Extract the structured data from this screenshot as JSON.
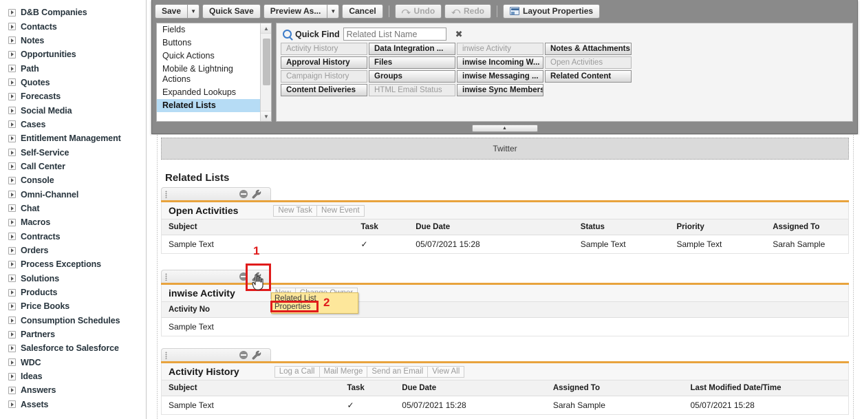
{
  "sidebar": {
    "items": [
      {
        "label": "D&B Companies"
      },
      {
        "label": "Contacts"
      },
      {
        "label": "Notes"
      },
      {
        "label": "Opportunities"
      },
      {
        "label": "Path"
      },
      {
        "label": "Quotes"
      },
      {
        "label": "Forecasts"
      },
      {
        "label": "Social Media"
      },
      {
        "label": "Cases"
      },
      {
        "label": "Entitlement Management"
      },
      {
        "label": "Self-Service"
      },
      {
        "label": "Call Center"
      },
      {
        "label": "Console"
      },
      {
        "label": "Omni-Channel"
      },
      {
        "label": "Chat"
      },
      {
        "label": "Macros"
      },
      {
        "label": "Contracts"
      },
      {
        "label": "Orders"
      },
      {
        "label": "Process Exceptions"
      },
      {
        "label": "Solutions"
      },
      {
        "label": "Products"
      },
      {
        "label": "Price Books"
      },
      {
        "label": "Consumption Schedules"
      },
      {
        "label": "Partners"
      },
      {
        "label": "Salesforce to Salesforce"
      },
      {
        "label": "WDC"
      },
      {
        "label": "Ideas"
      },
      {
        "label": "Answers"
      },
      {
        "label": "Assets"
      }
    ]
  },
  "toolbar": {
    "save_label": "Save",
    "quick_save_label": "Quick Save",
    "preview_as_label": "Preview As...",
    "cancel_label": "Cancel",
    "undo_label": "Undo",
    "redo_label": "Redo",
    "layout_properties_label": "Layout Properties",
    "dropdown_glyph": "▼"
  },
  "palette": {
    "categories": [
      {
        "label": "Fields",
        "selected": false
      },
      {
        "label": "Buttons",
        "selected": false
      },
      {
        "label": "Quick Actions",
        "selected": false
      },
      {
        "label": "Mobile & Lightning Actions",
        "selected": false
      },
      {
        "label": "Expanded Lookups",
        "selected": false
      },
      {
        "label": "Related Lists",
        "selected": true
      }
    ],
    "quick_find": {
      "label": "Quick Find",
      "placeholder": "Related List Name",
      "value": "",
      "clear_glyph": "✖"
    },
    "columns": [
      [
        {
          "label": "Activity History",
          "available": false
        },
        {
          "label": "Approval History",
          "available": true
        },
        {
          "label": "Campaign History",
          "available": false
        },
        {
          "label": "Content Deliveries",
          "available": true
        }
      ],
      [
        {
          "label": "Data Integration ...",
          "available": true
        },
        {
          "label": "Files",
          "available": true
        },
        {
          "label": "Groups",
          "available": true
        },
        {
          "label": "HTML Email Status",
          "available": false
        }
      ],
      [
        {
          "label": "inwise Activity",
          "available": false
        },
        {
          "label": "inwise Incoming W...",
          "available": true
        },
        {
          "label": "inwise Messaging ...",
          "available": true
        },
        {
          "label": "inwise Sync Members",
          "available": true
        }
      ],
      [
        {
          "label": "Notes & Attachments",
          "available": true
        },
        {
          "label": "Open Activities",
          "available": false
        },
        {
          "label": "Related Content",
          "available": true
        }
      ]
    ]
  },
  "canvas": {
    "twitter_section_label": "Twitter",
    "related_lists_heading": "Related Lists",
    "related_lists": [
      {
        "name": "Open Activities",
        "buttons": [
          "New Task",
          "New Event"
        ],
        "columns": [
          "Subject",
          "Task",
          "Due Date",
          "Status",
          "Priority",
          "Assigned To"
        ],
        "rows": [
          [
            "Sample Text",
            "✓",
            "05/07/2021 15:28",
            "Sample Text",
            "Sample Text",
            "Sarah Sample"
          ]
        ]
      },
      {
        "name": "inwise Activity",
        "buttons": [
          "New",
          "Change Owner"
        ],
        "columns": [
          "Activity No"
        ],
        "rows": [
          [
            "Sample Text"
          ]
        ]
      },
      {
        "name": "Activity History",
        "buttons": [
          "Log a Call",
          "Mail Merge",
          "Send an Email",
          "View All"
        ],
        "columns": [
          "Subject",
          "Task",
          "Due Date",
          "Assigned To",
          "Last Modified Date/Time"
        ],
        "rows": [
          [
            "Sample Text",
            "✓",
            "05/07/2021 15:28",
            "Sarah Sample",
            "05/07/2021 15:28"
          ]
        ]
      }
    ]
  },
  "annotations": {
    "step_one": "1",
    "step_two": "2",
    "tooltip_line1": "Related List",
    "tooltip_line2": "Properties",
    "highlight_color": "#e01b1b"
  }
}
